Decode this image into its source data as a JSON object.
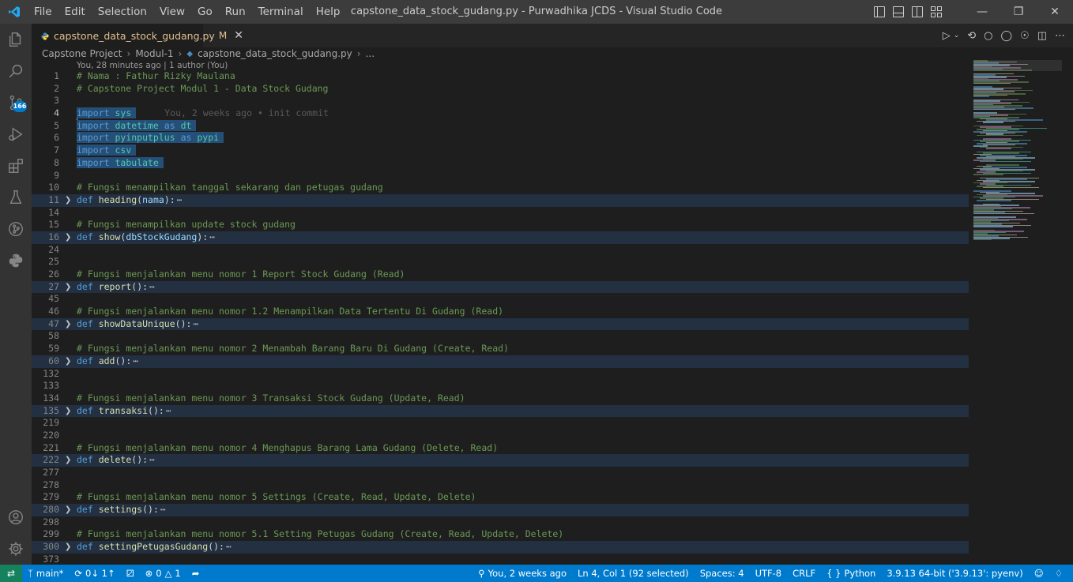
{
  "app": {
    "window_title": "capstone_data_stock_gudang.py - Purwadhika JCDS - Visual Studio Code",
    "menu": [
      "File",
      "Edit",
      "Selection",
      "View",
      "Go",
      "Run",
      "Terminal",
      "Help"
    ]
  },
  "activity_bar": {
    "source_control_badge": "166"
  },
  "tab": {
    "filename": "capstone_data_stock_gudang.py",
    "status": "M"
  },
  "breadcrumb": [
    "Capstone Project",
    "Modul-1",
    "capstone_data_stock_gudang.py",
    "..."
  ],
  "codelens": "You, 28 minutes ago | 1 author (You)",
  "editor": {
    "blame": "You, 2 weeks ago • init commit",
    "lines": [
      {
        "n": "1",
        "kind": "comment",
        "text": "# Nama : Fathur Rizky Maulana"
      },
      {
        "n": "2",
        "kind": "comment",
        "text": "# Capstone Project Modul 1 - Data Stock Gudang"
      },
      {
        "n": "3",
        "kind": "blank",
        "text": ""
      },
      {
        "n": "4",
        "kind": "import",
        "module": "sys"
      },
      {
        "n": "5",
        "kind": "import_as",
        "module": "datetime",
        "alias": "dt"
      },
      {
        "n": "6",
        "kind": "import_as",
        "module": "pyinputplus",
        "alias": "pypi"
      },
      {
        "n": "7",
        "kind": "import",
        "module": "csv"
      },
      {
        "n": "8",
        "kind": "import",
        "module": "tabulate"
      },
      {
        "n": "9",
        "kind": "blank",
        "text": ""
      },
      {
        "n": "10",
        "kind": "comment",
        "text": "# Fungsi menampilkan tanggal sekarang dan petugas gudang"
      },
      {
        "n": "11",
        "kind": "def",
        "name": "heading",
        "param": "nama"
      },
      {
        "n": "14",
        "kind": "blank",
        "text": ""
      },
      {
        "n": "15",
        "kind": "comment",
        "text": "# Fungsi menampilkan update stock gudang"
      },
      {
        "n": "16",
        "kind": "def",
        "name": "show",
        "param": "dbStockGudang"
      },
      {
        "n": "24",
        "kind": "blank",
        "text": ""
      },
      {
        "n": "25",
        "kind": "blank",
        "text": ""
      },
      {
        "n": "26",
        "kind": "comment",
        "text": "# Fungsi menjalankan menu nomor 1 Report Stock Gudang (Read)"
      },
      {
        "n": "27",
        "kind": "def",
        "name": "report",
        "param": ""
      },
      {
        "n": "45",
        "kind": "blank",
        "text": ""
      },
      {
        "n": "46",
        "kind": "comment",
        "text": "# Fungsi menjalankan menu nomor 1.2 Menampilkan Data Tertentu Di Gudang (Read)"
      },
      {
        "n": "47",
        "kind": "def",
        "name": "showDataUnique",
        "param": ""
      },
      {
        "n": "58",
        "kind": "blank",
        "text": ""
      },
      {
        "n": "59",
        "kind": "comment",
        "text": "# Fungsi menjalankan menu nomor 2 Menambah Barang Baru Di Gudang (Create, Read)"
      },
      {
        "n": "60",
        "kind": "def",
        "name": "add",
        "param": ""
      },
      {
        "n": "132",
        "kind": "blank",
        "text": ""
      },
      {
        "n": "133",
        "kind": "blank",
        "text": ""
      },
      {
        "n": "134",
        "kind": "comment",
        "text": "# Fungsi menjalankan menu nomor 3 Transaksi Stock Gudang (Update, Read)"
      },
      {
        "n": "135",
        "kind": "def",
        "name": "transaksi",
        "param": ""
      },
      {
        "n": "219",
        "kind": "blank",
        "text": ""
      },
      {
        "n": "220",
        "kind": "blank",
        "text": ""
      },
      {
        "n": "221",
        "kind": "comment",
        "text": "# Fungsi menjalankan menu nomor 4 Menghapus Barang Lama Gudang (Delete, Read)"
      },
      {
        "n": "222",
        "kind": "def",
        "name": "delete",
        "param": ""
      },
      {
        "n": "277",
        "kind": "blank",
        "text": ""
      },
      {
        "n": "278",
        "kind": "blank",
        "text": ""
      },
      {
        "n": "279",
        "kind": "comment",
        "text": "# Fungsi menjalankan menu nomor 5 Settings (Create, Read, Update, Delete)"
      },
      {
        "n": "280",
        "kind": "def",
        "name": "settings",
        "param": ""
      },
      {
        "n": "298",
        "kind": "blank",
        "text": ""
      },
      {
        "n": "299",
        "kind": "comment",
        "text": "# Fungsi menjalankan menu nomor 5.1 Setting Petugas Gudang (Create, Read, Update, Delete)"
      },
      {
        "n": "300",
        "kind": "def",
        "name": "settingPetugasGudang",
        "param": ""
      },
      {
        "n": "373",
        "kind": "blank",
        "text": ""
      }
    ]
  },
  "statusbar": {
    "branch": "main*",
    "sync": "0↓ 1↑",
    "errors": "0",
    "warnings": "1",
    "blame": "You, 2 weeks ago",
    "position": "Ln 4, Col 1 (92 selected)",
    "spaces": "Spaces: 4",
    "encoding": "UTF-8",
    "eol": "CRLF",
    "language": "Python",
    "interpreter": "3.9.13 64-bit ('3.9.13': pyenv)"
  }
}
